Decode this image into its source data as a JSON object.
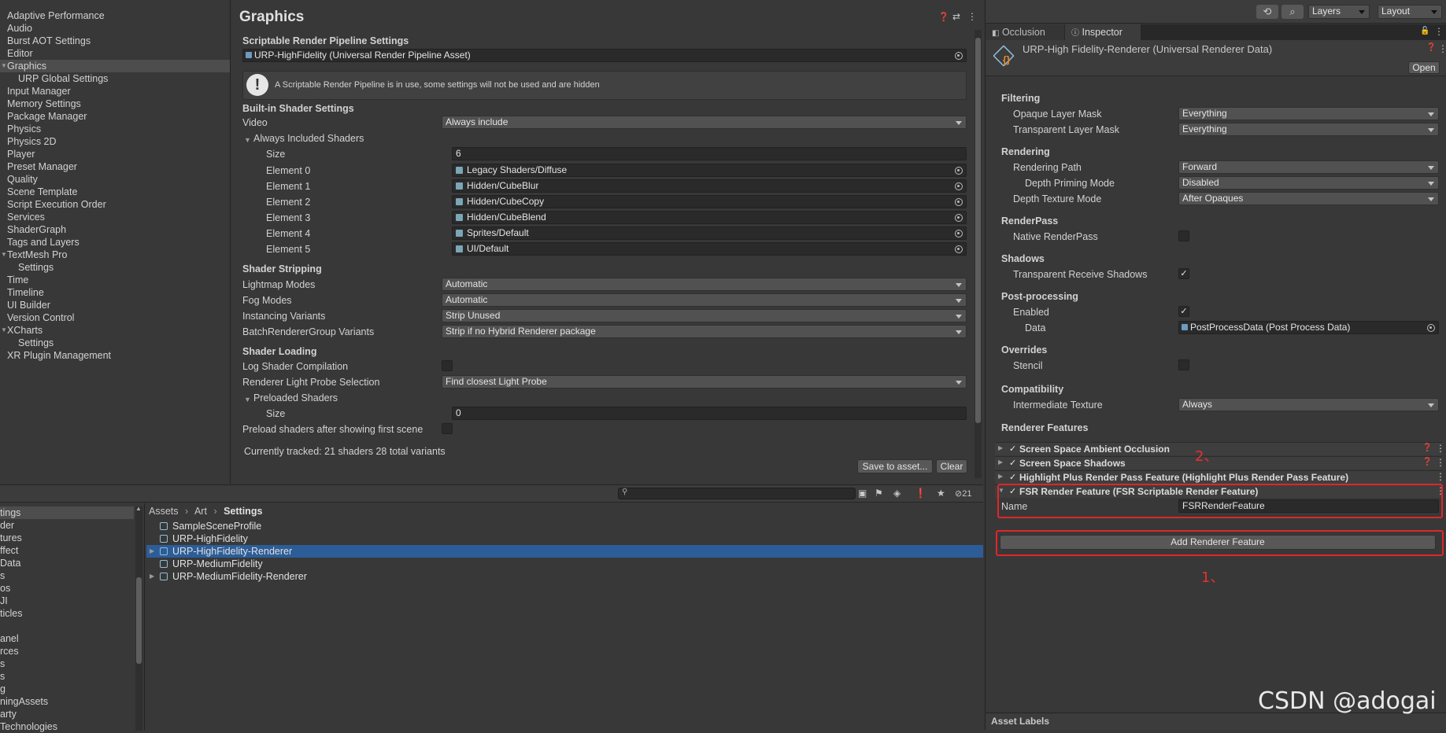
{
  "settings_nav": {
    "items": [
      {
        "label": "Adaptive Performance",
        "indent": 0,
        "selected": false,
        "expand": ""
      },
      {
        "label": "Audio",
        "indent": 0,
        "selected": false,
        "expand": ""
      },
      {
        "label": "Burst AOT Settings",
        "indent": 0,
        "selected": false,
        "expand": ""
      },
      {
        "label": "Editor",
        "indent": 0,
        "selected": false,
        "expand": ""
      },
      {
        "label": "Graphics",
        "indent": 0,
        "selected": true,
        "expand": "▼"
      },
      {
        "label": "URP Global Settings",
        "indent": 1,
        "selected": false,
        "expand": ""
      },
      {
        "label": "Input Manager",
        "indent": 0,
        "selected": false,
        "expand": ""
      },
      {
        "label": "Memory Settings",
        "indent": 0,
        "selected": false,
        "expand": ""
      },
      {
        "label": "Package Manager",
        "indent": 0,
        "selected": false,
        "expand": ""
      },
      {
        "label": "Physics",
        "indent": 0,
        "selected": false,
        "expand": ""
      },
      {
        "label": "Physics 2D",
        "indent": 0,
        "selected": false,
        "expand": ""
      },
      {
        "label": "Player",
        "indent": 0,
        "selected": false,
        "expand": ""
      },
      {
        "label": "Preset Manager",
        "indent": 0,
        "selected": false,
        "expand": ""
      },
      {
        "label": "Quality",
        "indent": 0,
        "selected": false,
        "expand": ""
      },
      {
        "label": "Scene Template",
        "indent": 0,
        "selected": false,
        "expand": ""
      },
      {
        "label": "Script Execution Order",
        "indent": 0,
        "selected": false,
        "expand": ""
      },
      {
        "label": "Services",
        "indent": 0,
        "selected": false,
        "expand": ""
      },
      {
        "label": "ShaderGraph",
        "indent": 0,
        "selected": false,
        "expand": ""
      },
      {
        "label": "Tags and Layers",
        "indent": 0,
        "selected": false,
        "expand": ""
      },
      {
        "label": "TextMesh Pro",
        "indent": 0,
        "selected": false,
        "expand": "▼"
      },
      {
        "label": "Settings",
        "indent": 1,
        "selected": false,
        "expand": ""
      },
      {
        "label": "Time",
        "indent": 0,
        "selected": false,
        "expand": ""
      },
      {
        "label": "Timeline",
        "indent": 0,
        "selected": false,
        "expand": ""
      },
      {
        "label": "UI Builder",
        "indent": 0,
        "selected": false,
        "expand": ""
      },
      {
        "label": "Version Control",
        "indent": 0,
        "selected": false,
        "expand": ""
      },
      {
        "label": "XCharts",
        "indent": 0,
        "selected": false,
        "expand": "▼"
      },
      {
        "label": "Settings",
        "indent": 1,
        "selected": false,
        "expand": ""
      },
      {
        "label": "XR Plugin Management",
        "indent": 0,
        "selected": false,
        "expand": ""
      }
    ]
  },
  "graphics": {
    "title": "Graphics",
    "srp_header": "Scriptable Render Pipeline Settings",
    "srp_asset": "URP-HighFidelity (Universal Render Pipeline Asset)",
    "srp_notice": "A Scriptable Render Pipeline is in use, some settings will not be used and are hidden",
    "builtin_header": "Built-in Shader Settings",
    "video_label": "Video",
    "video_value": "Always include",
    "always_included_label": "Always Included Shaders",
    "size_label": "Size",
    "size_value": "6",
    "elements": [
      {
        "label": "Element 0",
        "value": "Legacy Shaders/Diffuse"
      },
      {
        "label": "Element 1",
        "value": "Hidden/CubeBlur"
      },
      {
        "label": "Element 2",
        "value": "Hidden/CubeCopy"
      },
      {
        "label": "Element 3",
        "value": "Hidden/CubeBlend"
      },
      {
        "label": "Element 4",
        "value": "Sprites/Default"
      },
      {
        "label": "Element 5",
        "value": "UI/Default"
      }
    ],
    "stripping_header": "Shader Stripping",
    "stripping": [
      {
        "label": "Lightmap Modes",
        "value": "Automatic"
      },
      {
        "label": "Fog Modes",
        "value": "Automatic"
      },
      {
        "label": "Instancing Variants",
        "value": "Strip Unused"
      },
      {
        "label": "BatchRendererGroup Variants",
        "value": "Strip if no Hybrid Renderer package"
      }
    ],
    "loading_header": "Shader Loading",
    "log_compilation_label": "Log Shader Compilation",
    "light_probe_label": "Renderer Light Probe Selection",
    "light_probe_value": "Find closest Light Probe",
    "preloaded_label": "Preloaded Shaders",
    "preloaded_size_label": "Size",
    "preloaded_size_value": "0",
    "preload_after_label": "Preload shaders after showing first scene",
    "tracked_text": "Currently tracked: 21 shaders 28 total variants",
    "save_button": "Save to asset...",
    "clear_button": "Clear"
  },
  "project": {
    "left_items": [
      "tings",
      "der",
      "tures",
      "ffect",
      "Data",
      "s",
      "os",
      "JI",
      "ticles",
      "",
      "anel",
      "rces",
      "s",
      "s",
      "g",
      "ningAssets",
      "arty",
      "Technologies"
    ],
    "breadcrumb": [
      "Assets",
      "Art",
      "Settings"
    ],
    "assets": [
      {
        "label": "SampleSceneProfile",
        "selected": false,
        "expandable": false
      },
      {
        "label": "URP-HighFidelity",
        "selected": false,
        "expandable": false
      },
      {
        "label": "URP-HighFidelity-Renderer",
        "selected": true,
        "expandable": true
      },
      {
        "label": "URP-MediumFidelity",
        "selected": false,
        "expandable": false
      },
      {
        "label": "URP-MediumFidelity-Renderer",
        "selected": false,
        "expandable": true
      }
    ],
    "hidden_count": "21"
  },
  "toolbar": {
    "layers": "Layers",
    "layout": "Layout"
  },
  "inspector": {
    "tab_occlusion": "Occlusion",
    "tab_inspector": "Inspector",
    "asset_title": "URP-High Fidelity-Renderer (Universal Renderer Data)",
    "open_button": "Open",
    "filtering_header": "Filtering",
    "opaque_label": "Opaque Layer Mask",
    "opaque_value": "Everything",
    "transparent_label": "Transparent Layer Mask",
    "transparent_value": "Everything",
    "rendering_header": "Rendering",
    "rendering_path_label": "Rendering Path",
    "rendering_path_value": "Forward",
    "depth_priming_label": "Depth Priming Mode",
    "depth_priming_value": "Disabled",
    "depth_texture_label": "Depth Texture Mode",
    "depth_texture_value": "After Opaques",
    "renderpass_header": "RenderPass",
    "native_renderpass_label": "Native RenderPass",
    "shadows_header": "Shadows",
    "transparent_shadows_label": "Transparent Receive Shadows",
    "post_header": "Post-processing",
    "enabled_label": "Enabled",
    "data_label": "Data",
    "data_value": "PostProcessData (Post Process Data)",
    "overrides_header": "Overrides",
    "stencil_label": "Stencil",
    "compat_header": "Compatibility",
    "intermediate_label": "Intermediate Texture",
    "intermediate_value": "Always",
    "features_header": "Renderer Features",
    "features": [
      {
        "label": "Screen Space Ambient Occlusion",
        "help": true,
        "expanded": false
      },
      {
        "label": "Screen Space Shadows",
        "help": true,
        "expanded": false
      },
      {
        "label": "Highlight Plus Render Pass Feature (Highlight Plus Render Pass Feature)",
        "help": false,
        "expanded": false
      },
      {
        "label": "FSR Render Feature (FSR Scriptable Render Feature)",
        "help": false,
        "expanded": true
      }
    ],
    "fsr_name_label": "Name",
    "fsr_name_value": "FSRRenderFeature",
    "add_feature_button": "Add Renderer Feature",
    "asset_labels": "Asset Labels"
  },
  "annotations": {
    "label_1": "1、",
    "label_2": "2、",
    "watermark": "CSDN @adogai",
    "color": "#e0262a"
  }
}
